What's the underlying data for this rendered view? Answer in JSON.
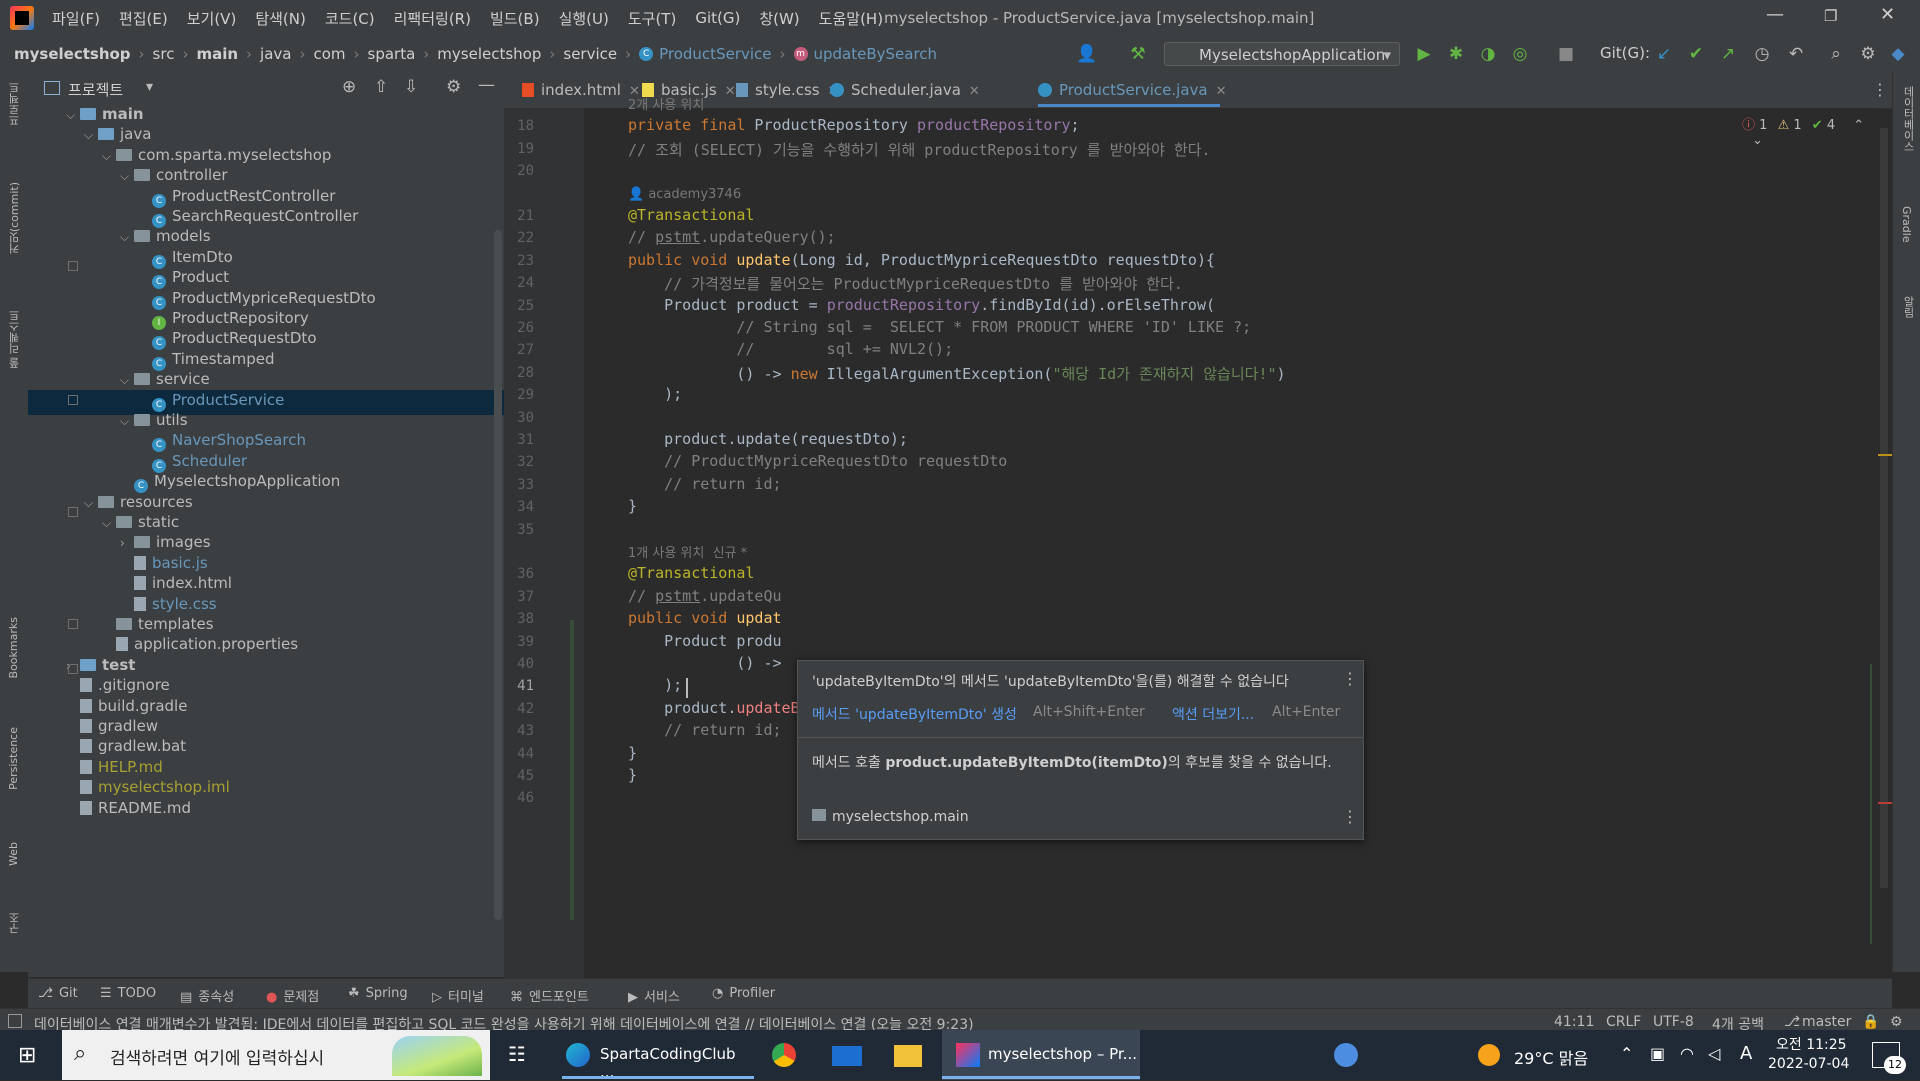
{
  "titlebar": {
    "menus": [
      "파일(F)",
      "편집(E)",
      "보기(V)",
      "탐색(N)",
      "코드(C)",
      "리팩터링(R)",
      "빌드(B)",
      "실행(U)",
      "도구(T)",
      "Git(G)",
      "창(W)",
      "도움말(H)"
    ],
    "title": "myselectshop - ProductService.java [myselectshop.main]"
  },
  "breadcrumb": [
    "myselectshop",
    "src",
    "main",
    "java",
    "com",
    "sparta",
    "myselectshop",
    "service"
  ],
  "breadcrumb_class": "ProductService",
  "breadcrumb_method": "updateBySearch",
  "run_config": "MyselectshopApplication",
  "git_label": "Git(G):",
  "project_panel": {
    "title": "프로젝트",
    "tree": [
      {
        "label": "main",
        "kind": "folder-blue",
        "depth": 2,
        "open": true,
        "bold": true
      },
      {
        "label": "java",
        "kind": "folder-blue",
        "depth": 3,
        "open": true
      },
      {
        "label": "com.sparta.myselectshop",
        "kind": "folder",
        "depth": 4,
        "open": true
      },
      {
        "label": "controller",
        "kind": "folder",
        "depth": 5,
        "open": true
      },
      {
        "label": "ProductRestController",
        "kind": "class",
        "depth": 6
      },
      {
        "label": "SearchRequestController",
        "kind": "class",
        "depth": 6
      },
      {
        "label": "models",
        "kind": "folder",
        "depth": 5,
        "open": true
      },
      {
        "label": "ItemDto",
        "kind": "class",
        "depth": 6
      },
      {
        "label": "Product",
        "kind": "class",
        "depth": 6
      },
      {
        "label": "ProductMypriceRequestDto",
        "kind": "class",
        "depth": 6
      },
      {
        "label": "ProductRepository",
        "kind": "interface",
        "depth": 6
      },
      {
        "label": "ProductRequestDto",
        "kind": "class",
        "depth": 6
      },
      {
        "label": "Timestamped",
        "kind": "class",
        "depth": 6
      },
      {
        "label": "service",
        "kind": "folder",
        "depth": 5,
        "open": true
      },
      {
        "label": "ProductService",
        "kind": "class",
        "depth": 6,
        "selected": true,
        "color": "#6897bb"
      },
      {
        "label": "utils",
        "kind": "folder",
        "depth": 5,
        "open": true
      },
      {
        "label": "NaverShopSearch",
        "kind": "class",
        "depth": 6,
        "color": "#6897bb"
      },
      {
        "label": "Scheduler",
        "kind": "class",
        "depth": 6,
        "color": "#6897bb"
      },
      {
        "label": "MyselectshopApplication",
        "kind": "class",
        "depth": 5
      },
      {
        "label": "resources",
        "kind": "folder",
        "depth": 3,
        "open": true
      },
      {
        "label": "static",
        "kind": "folder",
        "depth": 4,
        "open": true
      },
      {
        "label": "images",
        "kind": "folder",
        "depth": 5,
        "open": false
      },
      {
        "label": "basic.js",
        "kind": "file",
        "depth": 5,
        "color": "#6897bb"
      },
      {
        "label": "index.html",
        "kind": "file",
        "depth": 5
      },
      {
        "label": "style.css",
        "kind": "file",
        "depth": 5,
        "color": "#6897bb"
      },
      {
        "label": "templates",
        "kind": "folder",
        "depth": 4
      },
      {
        "label": "application.properties",
        "kind": "file",
        "depth": 4
      },
      {
        "label": "test",
        "kind": "folder-blue",
        "depth": 2,
        "open": false,
        "bold": true
      },
      {
        "label": ".gitignore",
        "kind": "file",
        "depth": 2
      },
      {
        "label": "build.gradle",
        "kind": "file",
        "depth": 2
      },
      {
        "label": "gradlew",
        "kind": "file",
        "depth": 2
      },
      {
        "label": "gradlew.bat",
        "kind": "file",
        "depth": 2
      },
      {
        "label": "HELP.md",
        "kind": "file",
        "depth": 2,
        "color": "#a8a032"
      },
      {
        "label": "myselectshop.iml",
        "kind": "file",
        "depth": 2,
        "color": "#a8a032"
      },
      {
        "label": "README.md",
        "kind": "file",
        "depth": 2
      }
    ]
  },
  "tabs": [
    {
      "label": "index.html",
      "active": false
    },
    {
      "label": "basic.js",
      "active": false
    },
    {
      "label": "style.css",
      "active": false
    },
    {
      "label": "Scheduler.java",
      "active": false
    },
    {
      "label": "ProductService.java",
      "active": true
    }
  ],
  "inspection": {
    "errors": "1",
    "warnings": "1",
    "ok": "4"
  },
  "code_lines": [
    {
      "n": "",
      "html": "<span class='hint'>2개 사용 위치</span>"
    },
    {
      "n": "18",
      "html": "<span class='kw'>private final</span> ProductRepository <span class='fd'>productRepository</span>;"
    },
    {
      "n": "19",
      "html": "<span class='cm'>// 조회 (SELECT) 기능을 수행하기 위해 productRepository 를 받아와야 한다.</span>"
    },
    {
      "n": "20",
      "html": ""
    },
    {
      "n": "",
      "html": "<span class='hint'>&#x1F464; academy3746</span>"
    },
    {
      "n": "21",
      "html": "<span class='an'>@Transactional</span>"
    },
    {
      "n": "22",
      "html": "<span class='cm'>// <u>pstmt</u>.updateQuery();</span>"
    },
    {
      "n": "23",
      "html": "<span class='kw'>public void</span> <span class='fn'>update</span>(Long id, ProductMypriceRequestDto requestDto){"
    },
    {
      "n": "24",
      "html": "    <span class='cm'>// 가격정보를 물어오는 ProductMypriceRequestDto 를 받아와야 한다.</span>"
    },
    {
      "n": "25",
      "html": "    Product product = <span class='fd'>productRepository</span>.findById(id).orElseThrow("
    },
    {
      "n": "26",
      "html": "            <span class='cm'>// String sql =  SELECT * FROM PRODUCT WHERE 'ID' LIKE ?;</span>"
    },
    {
      "n": "27",
      "html": "            <span class='cm'>//        sql += NVL2();</span>"
    },
    {
      "n": "28",
      "html": "            () -&gt; <span class='kw'>new</span> IllegalArgumentException(<span class='st'>\"해당 Id가 존재하지 않습니다!\"</span>)"
    },
    {
      "n": "29",
      "html": "    );"
    },
    {
      "n": "30",
      "html": ""
    },
    {
      "n": "31",
      "html": "    product.update(requestDto);"
    },
    {
      "n": "32",
      "html": "    <span class='cm'>// ProductMypriceRequestDto requestDto</span>"
    },
    {
      "n": "33",
      "html": "    <span class='cm'>// return id;</span>"
    },
    {
      "n": "34",
      "html": "}"
    },
    {
      "n": "35",
      "html": ""
    },
    {
      "n": "",
      "html": "<span class='hint'>1개 사용 위치  신규 *</span>"
    },
    {
      "n": "36",
      "html": "<span class='an'>@Transactional</span>"
    },
    {
      "n": "37",
      "html": "<span class='cm'>// <u>pstmt</u>.updateQu</span>"
    },
    {
      "n": "38",
      "html": "<span class='kw'>public void</span> <span class='fn'>updat</span>"
    },
    {
      "n": "39",
      "html": "    Product produ"
    },
    {
      "n": "40",
      "html": "            () -&gt;"
    },
    {
      "n": "41",
      "html": "    );"
    },
    {
      "n": "42",
      "html": "    product.<span class='er'>updateByItemDto</span>(itemDto);"
    },
    {
      "n": "43",
      "html": "    <span class='cm'>// return id;</span>"
    },
    {
      "n": "44",
      "html": "}"
    },
    {
      "n": "45",
      "html": "}"
    },
    {
      "n": "46",
      "html": ""
    }
  ],
  "popup": {
    "title": "'updateByItemDto'의 메서드 'updateByItemDto'을(를) 해결할 수 없습니다",
    "action1": "메서드 'updateByItemDto' 생성",
    "action1_key": "Alt+Shift+Enter",
    "action2": "액션 더보기...",
    "action2_key": "Alt+Enter",
    "body_pre": "메서드 호출 ",
    "body_bold": "product.updateByItemDto(itemDto)",
    "body_post": "의 후보를 찾을 수 없습니다.",
    "module": "myselectshop.main"
  },
  "tool_tabs": [
    "Git",
    "TODO",
    "종속성",
    "문제점",
    "Spring",
    "터미널",
    "엔드포인트",
    "서비스",
    "Profiler"
  ],
  "left_strip": [
    "프로젝트",
    "커밋(commit)",
    "풀 리퀘스트",
    "Bookmarks",
    "Persistence",
    "Web",
    "구조"
  ],
  "right_strip": [
    "데이터베이스",
    "Gradle",
    "알림"
  ],
  "status": {
    "message": "데이터베이스 연결 매개변수가 발견됨: IDE에서 데이터를 편집하고 SQL 코드 완성을 사용하기 위해 데이터베이스에 연결 // 데이터베이스 연결 (오늘 오전 9:23)",
    "position": "41:11",
    "line_sep": "CRLF",
    "encoding": "UTF-8",
    "indent": "4개 공백",
    "branch": "master"
  },
  "taskbar": {
    "search_placeholder": "검색하려면 여기에 입력하십시",
    "apps": [
      "SpartaCodingClub ...",
      "myselectshop – Pr..."
    ],
    "weather": "29°C  맑음",
    "time": "오전 11:25",
    "date": "2022-07-04",
    "ime": "A",
    "notifications": "12"
  }
}
